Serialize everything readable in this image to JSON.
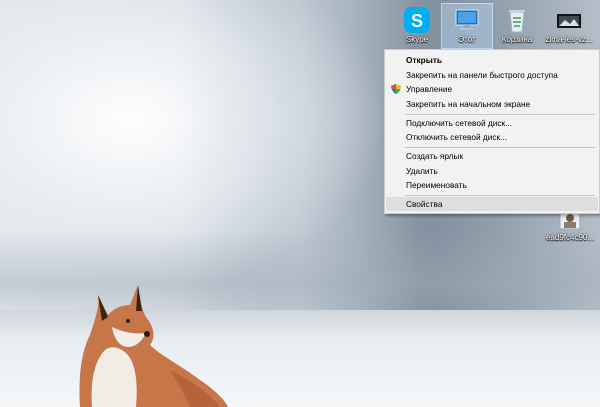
{
  "desktop": {
    "icons": [
      {
        "label": "Skype",
        "icon": "skype-icon"
      },
      {
        "label": "Этот",
        "icon": "this-pc-icon"
      },
      {
        "label": "Корзина",
        "icon": "recycle-bin-icon"
      },
      {
        "label": "zima-les-vz...",
        "icon": "image-file-icon"
      }
    ],
    "lower_icon": {
      "label": "ead9fc4c90...",
      "icon": "image-file-icon"
    }
  },
  "context_menu": {
    "items": [
      {
        "label": "Открыть",
        "bold": true
      },
      {
        "label": "Закрепить на панели быстрого доступа"
      },
      {
        "label": "Управление",
        "icon": "uac-shield-icon"
      },
      {
        "label": "Закрепить на начальном экране"
      },
      {
        "label": "Подключить сетевой диск..."
      },
      {
        "label": "Отключить сетевой диск..."
      },
      {
        "label": "Создать ярлык"
      },
      {
        "label": "Удалить"
      },
      {
        "label": "Переименовать"
      },
      {
        "label": "Свойства",
        "hovered": true
      }
    ]
  }
}
